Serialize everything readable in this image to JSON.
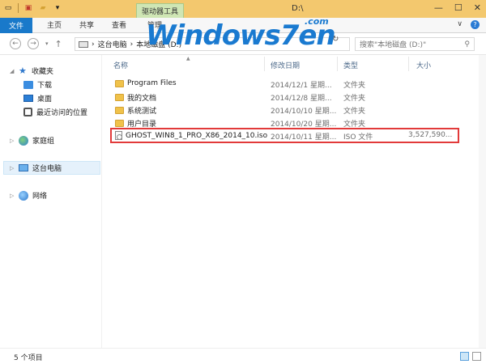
{
  "titlebar": {
    "context_tab": "驱动器工具",
    "title": "D:\\",
    "qat_icons": [
      "drive-icon",
      "properties-icon",
      "new-folder-icon",
      "dropdown-icon"
    ],
    "controls": [
      "—",
      "☐",
      "✕"
    ]
  },
  "logo": {
    "text": "Windows7en",
    "com": ".com"
  },
  "ribbon": {
    "tabs": [
      "文件",
      "主页",
      "共享",
      "查看",
      "管理"
    ],
    "chevron": "∨",
    "help": "?"
  },
  "address": {
    "crumbs": [
      "这台电脑",
      "本地磁盘 (D:)"
    ],
    "search_placeholder": "搜索\"本地磁盘 (D:)\""
  },
  "nav": {
    "favorites": "收藏夹",
    "downloads": "下载",
    "desktop": "桌面",
    "recent": "最近访问的位置",
    "homegroup": "家庭组",
    "thispc": "这台电脑",
    "network": "网络"
  },
  "columns": {
    "name": "名称",
    "date": "修改日期",
    "type": "类型",
    "size": "大小"
  },
  "files": [
    {
      "name": "Program Files",
      "date": "2014/12/1 星期...",
      "type": "文件夹",
      "size": "",
      "kind": "folder"
    },
    {
      "name": "我的文档",
      "date": "2014/12/8 星期...",
      "type": "文件夹",
      "size": "",
      "kind": "folder"
    },
    {
      "name": "系统测试",
      "date": "2014/10/10 星期...",
      "type": "文件夹",
      "size": "",
      "kind": "folder"
    },
    {
      "name": "用户目录",
      "date": "2014/10/20 星期...",
      "type": "文件夹",
      "size": "",
      "kind": "folder"
    },
    {
      "name": "GHOST_WIN8_1_PRO_X86_2014_10.iso",
      "date": "2014/10/11 星期...",
      "type": "ISO 文件",
      "size": "3,527,590...",
      "kind": "iso"
    }
  ],
  "status": {
    "count": "5 个项目"
  },
  "colors": {
    "accent": "#1979ca",
    "titlebar": "#f3c86e",
    "highlight": "#e23a3a"
  }
}
